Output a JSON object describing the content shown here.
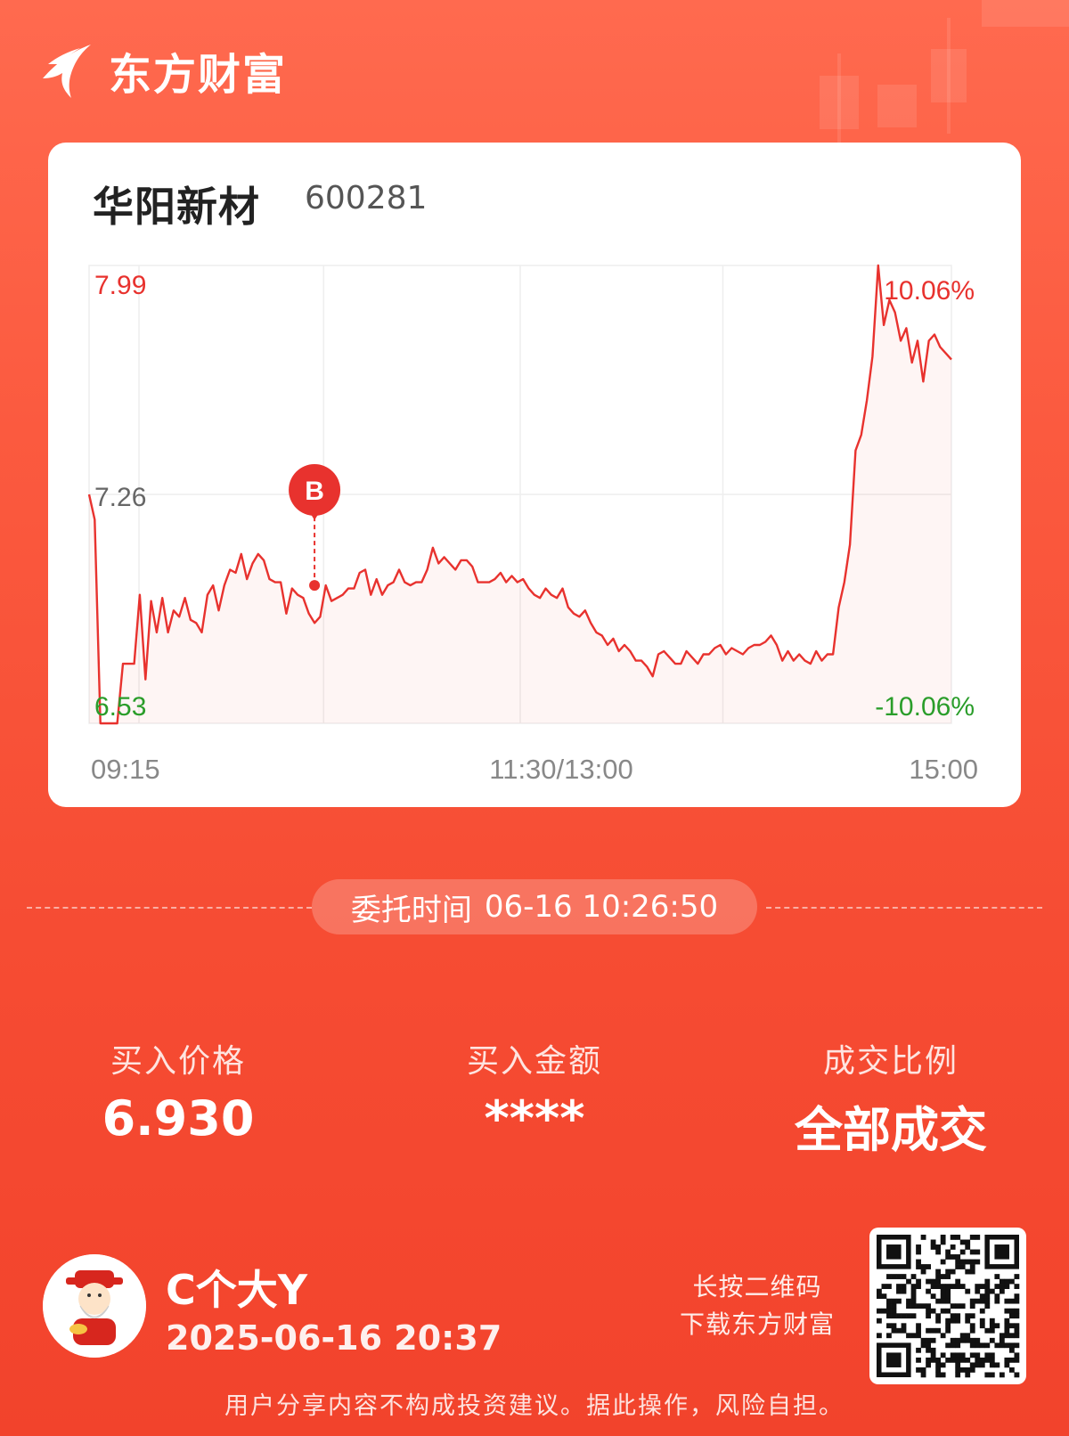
{
  "app": {
    "name": "东方财富"
  },
  "stock": {
    "name": "华阳新材",
    "code": "600281"
  },
  "chart_data": {
    "type": "line",
    "title": "",
    "y_labels": {
      "max_price": "7.99",
      "mid_price": "7.26",
      "min_price": "6.53",
      "max_pct": "10.06%",
      "min_pct": "-10.06%"
    },
    "ylim": [
      6.53,
      7.99
    ],
    "x_ticks": [
      "09:15",
      "11:30/13:00",
      "15:00"
    ],
    "grid": true,
    "series": [
      {
        "name": "",
        "values": [
          7.26,
          7.18,
          6.53,
          6.53,
          6.53,
          6.53,
          6.72,
          6.72,
          6.72,
          6.94,
          6.67,
          6.92,
          6.82,
          6.93,
          6.82,
          6.89,
          6.87,
          6.93,
          6.86,
          6.85,
          6.82,
          6.94,
          6.97,
          6.89,
          6.97,
          7.02,
          7.01,
          7.07,
          6.99,
          7.04,
          7.07,
          7.05,
          6.99,
          6.98,
          6.98,
          6.88,
          6.96,
          6.94,
          6.93,
          6.88,
          6.85,
          6.87,
          6.97,
          6.92,
          6.93,
          6.94,
          6.96,
          6.96,
          7.01,
          7.02,
          6.94,
          6.99,
          6.94,
          6.97,
          6.98,
          7.02,
          6.98,
          6.97,
          6.98,
          6.98,
          7.02,
          7.09,
          7.04,
          7.06,
          7.04,
          7.02,
          7.05,
          7.05,
          7.03,
          6.98,
          6.98,
          6.98,
          6.99,
          7.01,
          6.98,
          7.0,
          6.98,
          6.99,
          6.96,
          6.94,
          6.93,
          6.96,
          6.94,
          6.93,
          6.96,
          6.9,
          6.88,
          6.87,
          6.89,
          6.85,
          6.82,
          6.81,
          6.78,
          6.8,
          6.76,
          6.78,
          6.76,
          6.73,
          6.73,
          6.71,
          6.68,
          6.75,
          6.76,
          6.74,
          6.72,
          6.72,
          6.76,
          6.74,
          6.72,
          6.75,
          6.75,
          6.77,
          6.78,
          6.75,
          6.77,
          6.76,
          6.75,
          6.77,
          6.78,
          6.78,
          6.79,
          6.81,
          6.78,
          6.73,
          6.76,
          6.73,
          6.75,
          6.73,
          6.72,
          6.76,
          6.73,
          6.75,
          6.75,
          6.9,
          6.98,
          7.1,
          7.4,
          7.45,
          7.56,
          7.7,
          7.99,
          7.8,
          7.88,
          7.84,
          7.75,
          7.79,
          7.68,
          7.75,
          7.62,
          7.75,
          7.77,
          7.73,
          7.71,
          7.69
        ]
      }
    ]
  },
  "trade_marker": {
    "label": "B",
    "price": 6.97,
    "index": 40
  },
  "order": {
    "label": "委托时间",
    "time": "06-16 10:26:50"
  },
  "stats": [
    {
      "label": "买入价格",
      "value": "6.930"
    },
    {
      "label": "买入金额",
      "value": "****"
    },
    {
      "label": "成交比例",
      "value": "全部成交"
    }
  ],
  "user": {
    "name": "C个大Y",
    "share_time": "2025-06-16 20:37"
  },
  "qr": {
    "hint_line1": "长按二维码",
    "hint_line2": "下载东方财富"
  },
  "disclaimer": "用户分享内容不构成投资建议。据此操作，风险自担。",
  "colors": {
    "up": "#e8322e",
    "down": "#2a9d2a",
    "brand": "#f64c33"
  }
}
